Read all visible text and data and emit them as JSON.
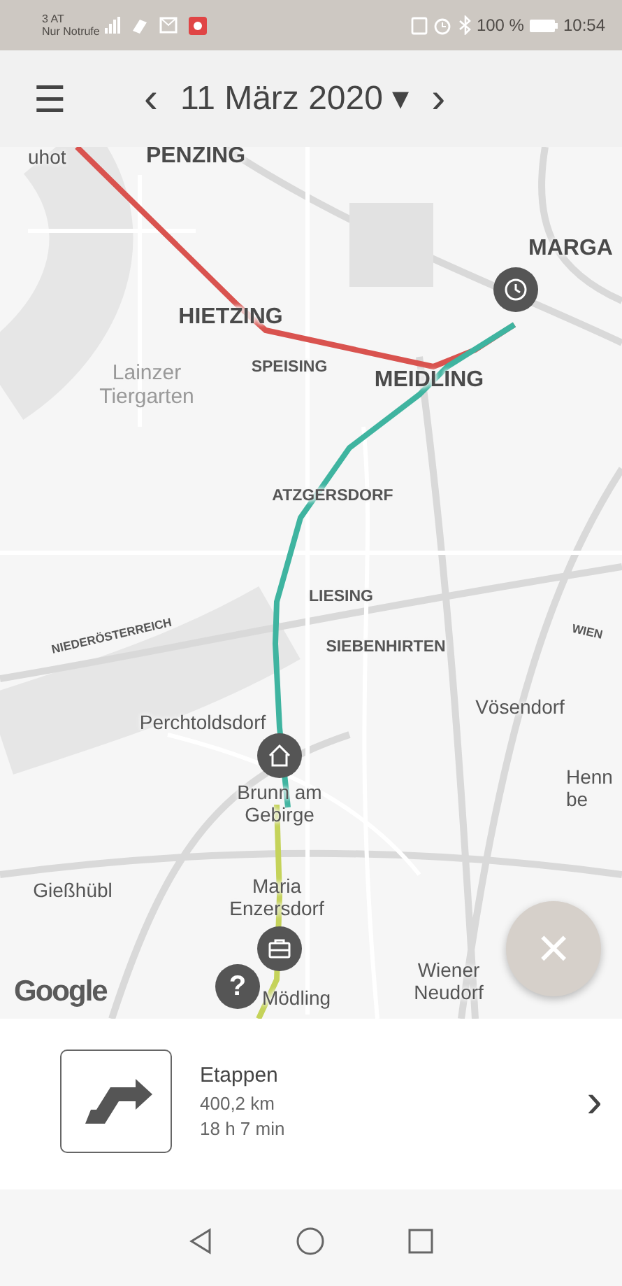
{
  "status_bar": {
    "carrier": "3 AT",
    "carrier_note": "Nur Notrufe",
    "battery": "100 %",
    "time": "10:54"
  },
  "header": {
    "menu": "☰",
    "prev": "‹",
    "date": "11 März 2020",
    "dropdown": "▾",
    "next": "›"
  },
  "map": {
    "labels": [
      {
        "text": [
          "uhot"
        ],
        "kind": "town"
      },
      {
        "text": [
          "PENZING"
        ],
        "kind": "district"
      },
      {
        "text": [
          "MARGA"
        ],
        "kind": "district"
      },
      {
        "text": [
          "HIETZING"
        ],
        "kind": "district"
      },
      {
        "text": [
          "Lainzer",
          "Tiergarten"
        ],
        "kind": "park"
      },
      {
        "text": [
          "SPEISING"
        ],
        "kind": "suburb"
      },
      {
        "text": [
          "MEIDLING"
        ],
        "kind": "district"
      },
      {
        "text": [
          "ATZGERSDORF"
        ],
        "kind": "suburb"
      },
      {
        "text": [
          "LIESING"
        ],
        "kind": "suburb"
      },
      {
        "text": [
          "NIEDERÖSTERREICH"
        ],
        "kind": "region"
      },
      {
        "text": [
          "SIEBENHIRTEN"
        ],
        "kind": "suburb"
      },
      {
        "text": [
          "WIEN"
        ],
        "kind": "region"
      },
      {
        "text": [
          "Vösendorf"
        ],
        "kind": "town"
      },
      {
        "text": [
          "Perchtoldsdorf"
        ],
        "kind": "town"
      },
      {
        "text": [
          "Henn",
          "be"
        ],
        "kind": "town"
      },
      {
        "text": [
          "Brunn am",
          "Gebirge"
        ],
        "kind": "town"
      },
      {
        "text": [
          "Gießhübl"
        ],
        "kind": "town"
      },
      {
        "text": [
          "Maria",
          "Enzersdorf"
        ],
        "kind": "town"
      },
      {
        "text": [
          "Wiener",
          "Neudorf"
        ],
        "kind": "town"
      },
      {
        "text": [
          "Mödling"
        ],
        "kind": "town"
      }
    ],
    "pins": [
      {
        "kind": "clock"
      },
      {
        "kind": "home"
      },
      {
        "kind": "work"
      },
      {
        "kind": "unknown",
        "text": "?"
      }
    ],
    "attribution": "Google",
    "close": "×"
  },
  "summary": {
    "title": "Etappen",
    "distance": "400,2 km",
    "duration": "18 h 7 min",
    "chevron": "›"
  }
}
